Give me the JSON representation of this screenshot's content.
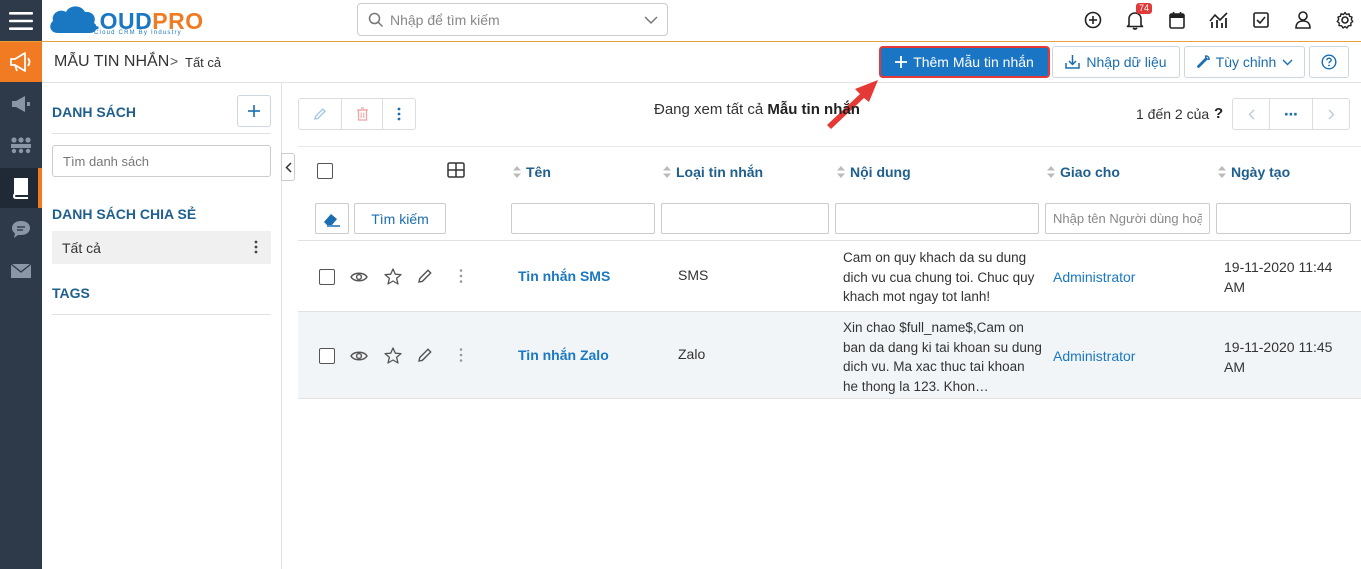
{
  "app": {
    "brand_part1": "CLOUD",
    "brand_part2": "PRO",
    "tagline": "Cloud CRM By Industry",
    "colors": {
      "brand_blue": "#1a78c2",
      "brand_orange": "#f07b22",
      "sidebar_bg": "#2e3a4a",
      "sidebar_active": "#f07b22",
      "accent": "#1a76c4",
      "highlight_border": "#e53935"
    }
  },
  "search": {
    "placeholder": "Nhập để tìm kiếm"
  },
  "topbar": {
    "icons": [
      "add-circle-icon",
      "bell-icon",
      "calendar-icon",
      "chart-icon",
      "checkbox-icon",
      "user-icon",
      "gear-icon"
    ],
    "notification_count": "74"
  },
  "sidebar": {
    "items": [
      "megaphone-icon",
      "megaphone-icon",
      "people-icon",
      "book-icon",
      "chat-icon",
      "mail-icon"
    ],
    "active_index": 3
  },
  "header": {
    "title": "MẪU TIN NHẮN",
    "separator": ">",
    "subtitle": "Tất cả",
    "add_button": "Thêm Mẫu tin nhắn",
    "import_button": "Nhập dữ liệu",
    "customize_button": "Tùy chỉnh"
  },
  "left_panel": {
    "list_title": "DANH SÁCH",
    "search_placeholder": "Tìm danh sách",
    "shared_title": "DANH SÁCH CHIA SẺ",
    "all_item": "Tất cả",
    "tags_title": "TAGS"
  },
  "toolbar": {
    "viewing_prefix": "Đang xem tất cả ",
    "viewing_module": "Mẫu tin nhắn",
    "pager_text": "1 đến 2 của",
    "pager_help": "?",
    "more": "⋯"
  },
  "grid": {
    "columns": [
      "Tên",
      "Loại tin nhắn",
      "Nội dung",
      "Giao cho",
      "Ngày tạo"
    ],
    "search_button": "Tìm kiếm",
    "assign_filter_placeholder": "Nhập tên Người dùng hoặc Nhóm",
    "rows": [
      {
        "name": "Tin nhắn SMS",
        "type": "SMS",
        "content": "Cam on quy khach da su dung dich vu cua chung toi. Chuc quy khach mot ngay tot lanh!",
        "assigned": "Administrator",
        "created": "19-11-2020 11:44 AM"
      },
      {
        "name": "Tin nhắn Zalo",
        "type": "Zalo",
        "content": "Xin chao $full_name$,Cam on ban da dang ki tai khoan su dung dich vu. Ma xac thuc tai khoan he thong la 123. Khon…",
        "assigned": "Administrator",
        "created": "19-11-2020 11:45 AM"
      }
    ]
  }
}
